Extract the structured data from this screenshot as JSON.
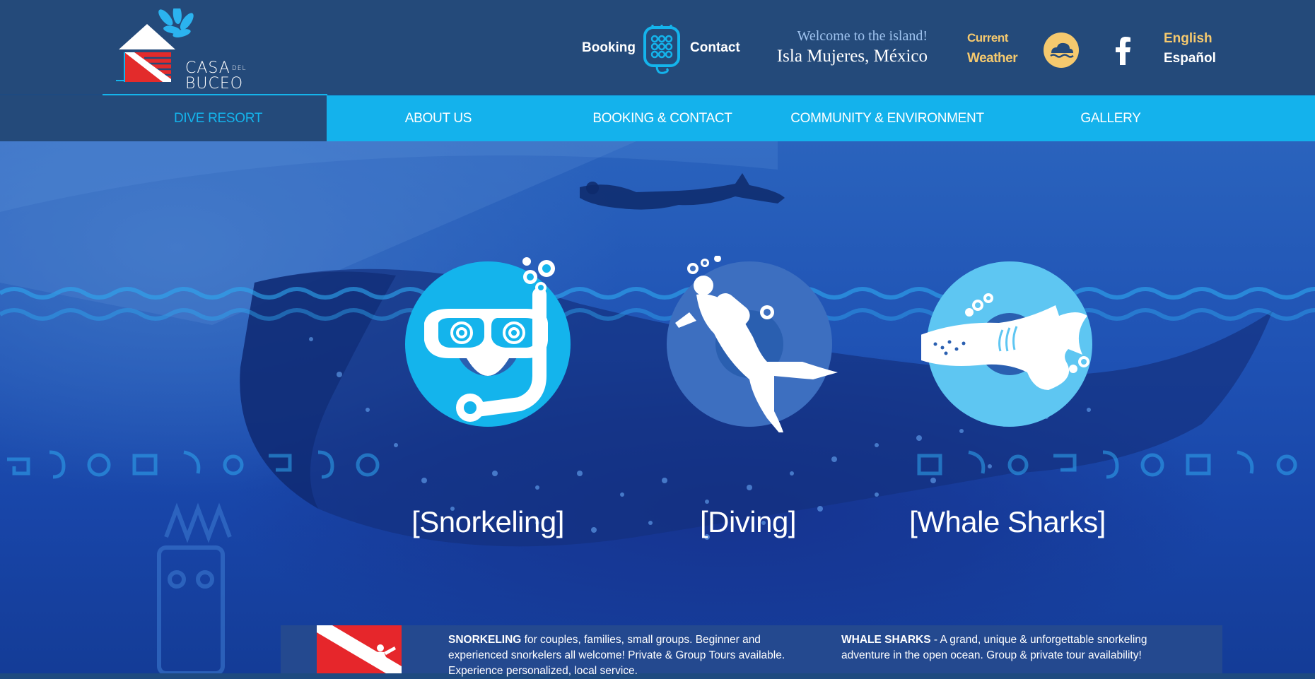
{
  "logo": {
    "line1": "CASA",
    "line1_small": "DEL",
    "line2": "BUCEO"
  },
  "top_links": {
    "booking": "Booking",
    "contact": "Contact"
  },
  "welcome": {
    "greeting": "Welcome to the island!",
    "place": "Isla Mujeres, México"
  },
  "weather": {
    "line1": "Current",
    "line2": "Weather"
  },
  "languages": {
    "english": "English",
    "spanish": "Español"
  },
  "nav": {
    "items": [
      {
        "label": "DIVE RESORT"
      },
      {
        "label": "ABOUT US"
      },
      {
        "label": "BOOKING & CONTACT"
      },
      {
        "label": "COMMUNITY & ENVIRONMENT"
      },
      {
        "label": "GALLERY"
      }
    ]
  },
  "activities": [
    {
      "label": "[Snorkeling]"
    },
    {
      "label": "[Diving]"
    },
    {
      "label": "[Whale Sharks]"
    }
  ],
  "info": {
    "snorkel_title": "SNORKELING",
    "snorkel_text": " for couples, families, small groups. Beginner and experienced snorkelers all welcome! Private & Group Tours available. Experience personalized, local service.",
    "whale_title": "WHALE SHARKS",
    "whale_text": " - A grand, unique & unforgettable snorkeling adventure in the open ocean. Group & private tour availability!"
  },
  "colors": {
    "header_bg": "#244a7a",
    "nav_bg": "#14b2ec",
    "accent_gold": "#f5c96e",
    "snorkel_circle": "#14b4ec",
    "diving_circle": "#3d6fc0",
    "whale_circle": "#5ec6f2"
  }
}
